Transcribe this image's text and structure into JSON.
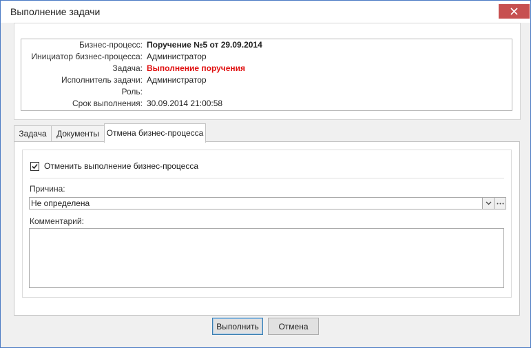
{
  "window": {
    "title": "Выполнение задачи",
    "close_symbol": "✕"
  },
  "info": {
    "rows": [
      {
        "label": "Бизнес-процесс:",
        "value": "Поручение №5 от 29.09.2014"
      },
      {
        "label": "Инициатор бизнес-процесса:",
        "value": "Администратор"
      },
      {
        "label": "Задача:",
        "value": "Выполнение поручения"
      },
      {
        "label": "Исполнитель задачи:",
        "value": "Администратор"
      },
      {
        "label": "Роль:",
        "value": ""
      },
      {
        "label": "Срок выполнения:",
        "value": "30.09.2014 21:00:58"
      }
    ]
  },
  "tabs": [
    {
      "label": "Задача",
      "active": false
    },
    {
      "label": "Документы",
      "active": false
    },
    {
      "label": "Отмена бизнес-процесса",
      "active": true
    }
  ],
  "cancel_panel": {
    "checkbox_label": "Отменить выполнение бизнес-процесса",
    "checkbox_checked": true,
    "reason_label": "Причина:",
    "reason_value": "Не определена",
    "dropdown_symbol": "⌵",
    "ellipsis_symbol": "···",
    "comment_label": "Комментарий:",
    "comment_value": ""
  },
  "buttons": {
    "execute": "Выполнить",
    "cancel": "Отмена"
  },
  "colors": {
    "accent_border": "#4a7ac4",
    "close_button": "#c75050",
    "task_red": "#e01010"
  }
}
